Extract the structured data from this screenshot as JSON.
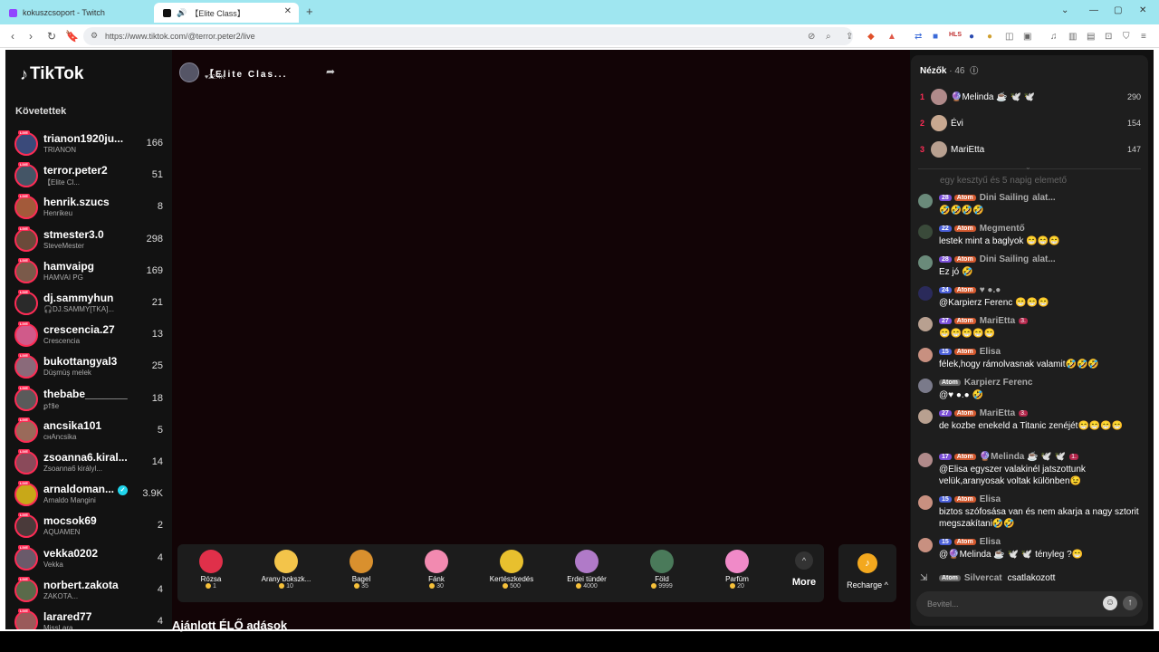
{
  "browser": {
    "tabs": [
      {
        "title": "kokuszcsoport - Twitch"
      },
      {
        "title": "【Elite Class】"
      }
    ],
    "url": "https://www.tiktok.com/@terror.peter2/live"
  },
  "sidebar": {
    "logo": "TikTok",
    "following_title": "Követettek",
    "live_label": "LIVE",
    "accounts": [
      {
        "name": "trianon1920ju...",
        "sub": "TRIANON",
        "count": "166",
        "color": "#3a4a7a"
      },
      {
        "name": "terror.peter2",
        "sub": "【Elite Cl...",
        "count": "51",
        "color": "#445566"
      },
      {
        "name": "henrik.szucs",
        "sub": "Henrikeu",
        "count": "8",
        "color": "#a35a3a"
      },
      {
        "name": "stmester3.0",
        "sub": "SteveMester",
        "count": "298",
        "color": "#6a4a3a"
      },
      {
        "name": "hamvaipg",
        "sub": "HAMVAI PG",
        "count": "169",
        "color": "#7a5a4a"
      },
      {
        "name": "dj.sammyhun",
        "sub": "🎧DJ.SAMMY[TKA]...",
        "count": "21",
        "color": "#2a2a2a"
      },
      {
        "name": "crescencia.27",
        "sub": "Crescencia",
        "count": "13",
        "color": "#d05a8a"
      },
      {
        "name": "bukottangyal3",
        "sub": "Düşmüş melek",
        "count": "25",
        "color": "#8a6a7a"
      },
      {
        "name": "thebabe_______",
        "sub": "ꝑꝉꝸe",
        "count": "18",
        "color": "#5a5a5a"
      },
      {
        "name": "ancsika101",
        "sub": "ᴄнAncsika",
        "count": "5",
        "color": "#9a6a5a"
      },
      {
        "name": "zsoanna6.kiral...",
        "sub": "Zsoanna6 királyl...",
        "count": "14",
        "color": "#8a4a5a"
      },
      {
        "name": "arnaldoman...",
        "sub": "Arnaldo Mangini",
        "count": "3.9K",
        "color": "#c8a818",
        "verified": true
      },
      {
        "name": "mocsok69",
        "sub": "AQUAMEN",
        "count": "2",
        "color": "#4a3a3a"
      },
      {
        "name": "vekka0202",
        "sub": "Vekka",
        "count": "4",
        "color": "#6a5a6a"
      },
      {
        "name": "norbert.zakota",
        "sub": "ZAKOTA...",
        "count": "4",
        "color": "#5a6a4a"
      },
      {
        "name": "larared77",
        "sub": "MissLara...",
        "count": "4",
        "color": "#9a5a5a"
      }
    ]
  },
  "stream": {
    "host_name": "【Elite Clas...",
    "host_likes": "♥22.4K",
    "recommended_title": "Ajánlott ÉLŐ adások"
  },
  "gifts": [
    {
      "name": "Rózsa",
      "price": "1",
      "color": "#e0304a"
    },
    {
      "name": "Arany bokszk...",
      "price": "10",
      "color": "#f3c44a"
    },
    {
      "name": "Bagel",
      "price": "35",
      "color": "#d9902e"
    },
    {
      "name": "Fánk",
      "price": "30",
      "color": "#f28ab0"
    },
    {
      "name": "Kertészkedés",
      "price": "500",
      "color": "#e8c02e"
    },
    {
      "name": "Erdei tündér",
      "price": "4000",
      "color": "#b07ac8"
    },
    {
      "name": "Föld",
      "price": "9999",
      "color": "#4a7a5a"
    },
    {
      "name": "Parfüm",
      "price": "20",
      "color": "#f08ac8"
    }
  ],
  "gift_bar": {
    "more_label": "More",
    "recharge_label": "Recharge ^"
  },
  "chat": {
    "viewers_label": "Nézők",
    "viewers_count": "· 46",
    "top_viewers": [
      {
        "rank": "1",
        "name": "🔮Melinda ☕ 🕊️ 🕊️",
        "score": "290",
        "color": "#b08a8a"
      },
      {
        "rank": "2",
        "name": "Évi",
        "score": "154",
        "color": "#c8a890"
      },
      {
        "rank": "3",
        "name": "MariEtta",
        "score": "147",
        "color": "#b8a090"
      }
    ],
    "faded_text": "egy kesztyű és 5 napig elemető",
    "messages": [
      {
        "level": "28",
        "badge": "Atom",
        "user": "Dini Sailing",
        "extra": "alat...",
        "text": "🤣🤣🤣🤣",
        "color": "#6a8a7a",
        "fan": ""
      },
      {
        "level": "22",
        "badge": "Atom",
        "user": "Megmentő",
        "extra": "",
        "text": "lestek mint a baglyok 😁😁😁",
        "color": "#3a4a3a",
        "fan": ""
      },
      {
        "level": "28",
        "badge": "Atom",
        "user": "Dini Sailing",
        "extra": "alat...",
        "text": "Ez jó 🤣",
        "color": "#6a8a7a",
        "fan": ""
      },
      {
        "level": "24",
        "badge": "Atom",
        "user": "♥ ●.●",
        "extra": "",
        "text": "@Karpierz Ferenc 😁😁😁",
        "color": "#2a2a5a",
        "fan": ""
      },
      {
        "level": "27",
        "badge": "Atom",
        "user": "MariEtta",
        "extra": "",
        "text": "😁😁😁😁😁",
        "color": "#b8a090",
        "fan": "3."
      },
      {
        "level": "15",
        "badge": "Atom",
        "user": "Elisa",
        "extra": "",
        "text": "félek,hogy rámolvasnak valamit🤣🤣🤣",
        "color": "#c89080",
        "fan": ""
      },
      {
        "level": "",
        "badge": "Atom",
        "user": "Karpierz Ferenc",
        "extra": "",
        "text": "@♥ ●.● 🤣",
        "color": "#7a7a8a",
        "fan": ""
      },
      {
        "level": "27",
        "badge": "Atom",
        "user": "MariEtta",
        "extra": "",
        "text": "de kozbe enekeld a Titanic zenéjét😁😁😁😁",
        "color": "#b8a090",
        "fan": "3."
      },
      {
        "level": "17",
        "badge": "Atom",
        "user": "🔮Melinda ☕ 🕊️ 🕊️",
        "extra": "",
        "text": "@Elisa egyszer valakinél jatszottunk velük,aranyosak voltak különben😉",
        "color": "#b08a8a",
        "fan": "1."
      },
      {
        "level": "15",
        "badge": "Atom",
        "user": "Elisa",
        "extra": "",
        "text": "biztos szófosása van és nem akarja a nagy sztorit megszakítani🤣🤣",
        "color": "#c89080",
        "fan": ""
      },
      {
        "level": "15",
        "badge": "Atom",
        "user": "Elisa",
        "extra": "",
        "text": "@🔮Melinda ☕ 🕊️ 🕊️ tényleg ?😁",
        "color": "#c89080",
        "fan": ""
      }
    ],
    "join": {
      "badge": "Atom",
      "user": "Silvercat",
      "text": "csatlakozott"
    },
    "input_placeholder": "Bevitel..."
  }
}
